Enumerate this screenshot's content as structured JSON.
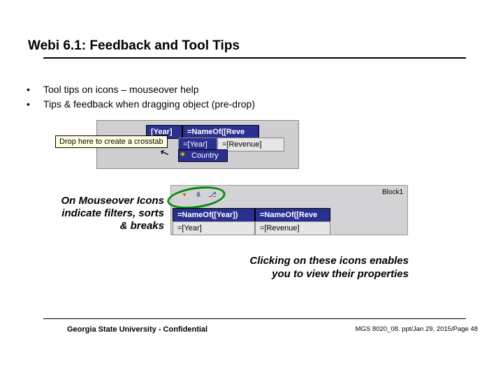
{
  "title": "Webi 6.1: Feedback and Tool Tips",
  "bullets": [
    "Tool tips on icons – mouseover help",
    "Tips & feedback when dragging object (pre-drop)"
  ],
  "img1": {
    "tooltip": "Drop here to create a crosstab",
    "header1": "[Year]",
    "header2": "=NameOf([Reve",
    "cell1": "=[Year]",
    "cell2": "=[Revenue]",
    "country": "Country"
  },
  "caption_left": [
    "On Mouseover Icons",
    "indicate filters, sorts",
    "& breaks"
  ],
  "img2": {
    "block_label": "Block1",
    "header1": "=NameOf([Year])",
    "header2": "=NameOf([Reve",
    "cell1": "=[Year]",
    "cell2": "=[Revenue]"
  },
  "caption_right": [
    "Clicking on these icons enables",
    "you to view their properties"
  ],
  "footer_left": "Georgia State University - Confidential",
  "footer_right": "MGS 8020_08. ppt/Jan 29, 2015/Page 48"
}
